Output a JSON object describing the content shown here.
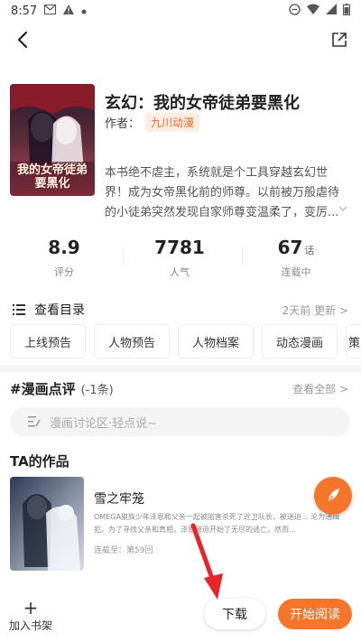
{
  "status_bar": {
    "time": "8:57"
  },
  "comic": {
    "title": "玄幻：我的女帝徒弟要黑化",
    "author_label": "作者：",
    "author": "九川动漫",
    "cover_text": "我的女帝徒弟要黑化",
    "description": "本书绝不虐主，系统就是个工具穿越玄幻世界！成为女帝黑化前的师尊。以前被万般虐待的小徒弟突然发现自家师尊变温柔了，变厉..."
  },
  "stats": [
    {
      "value": "8.9",
      "unit": "",
      "label": "评分"
    },
    {
      "value": "7781",
      "unit": "",
      "label": "人气"
    },
    {
      "value": "67",
      "unit": "话",
      "label": "连载中"
    }
  ],
  "catalog": {
    "label": "查看目录",
    "update": "2天前 更新 >"
  },
  "chips": [
    "上线预告",
    "人物预告",
    "人物档案",
    "动态漫画",
    "策"
  ],
  "reviews": {
    "title": "#漫画点评",
    "count": "(-1条)",
    "view_all": "查看全部 >",
    "placeholder": "漫画讨论区·轻点说~"
  },
  "works": {
    "title": "TA的作品",
    "items": [
      {
        "name": "雪之牢笼",
        "desc": "OMEGA狼族少年泽恩和父亲一起被陷害杀死了近卫队长，被迷迫... 沦为通缉犯。为了寻找父亲和真相，泽恩被迫开始了无尽的逃亡。然而...",
        "update": "连载至：第59回"
      }
    ]
  },
  "bottom": {
    "add_shelf": "加入书架",
    "download": "下载",
    "read": "开始阅读"
  },
  "colors": {
    "accent": "#f5752a",
    "arrow": "#e5242b"
  }
}
